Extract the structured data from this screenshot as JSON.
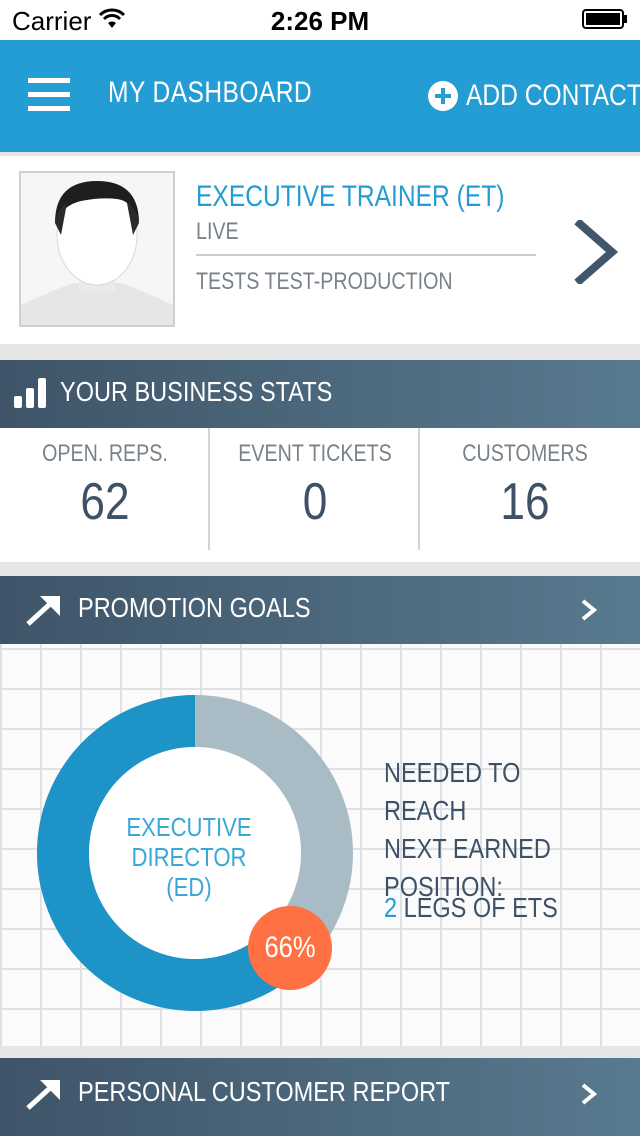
{
  "status_bar": {
    "carrier": "Carrier",
    "time": "2:26 PM"
  },
  "navbar": {
    "title": "MY DASHBOARD",
    "add_contact_label": "ADD CONTACT"
  },
  "profile": {
    "title": "EXECUTIVE TRAINER (ET)",
    "status": "LIVE",
    "organization": "TESTS TEST-PRODUCTION"
  },
  "business_stats": {
    "header": "YOUR BUSINESS STATS",
    "items": [
      {
        "label": "OPEN. REPS.",
        "value": "62"
      },
      {
        "label": "EVENT TICKETS",
        "value": "0"
      },
      {
        "label": "CUSTOMERS",
        "value": "16"
      }
    ]
  },
  "promotion_goals": {
    "header": "PROMOTION GOALS",
    "position_line1": "EXECUTIVE",
    "position_line2": "DIRECTOR",
    "position_line3": "(ED)",
    "progress_label": "66%",
    "progress": 0.66,
    "needed_line1": "NEEDED TO REACH",
    "needed_line2": "NEXT EARNED",
    "needed_line3": "POSITION:",
    "legs_count": "2",
    "legs_text": " LEGS OF ETS",
    "colors": {
      "filled": "#1e93c8",
      "remaining": "#a9bcc6",
      "badge": "#ff7043"
    }
  },
  "personal_report": {
    "header": "PERSONAL CUSTOMER REPORT"
  }
}
